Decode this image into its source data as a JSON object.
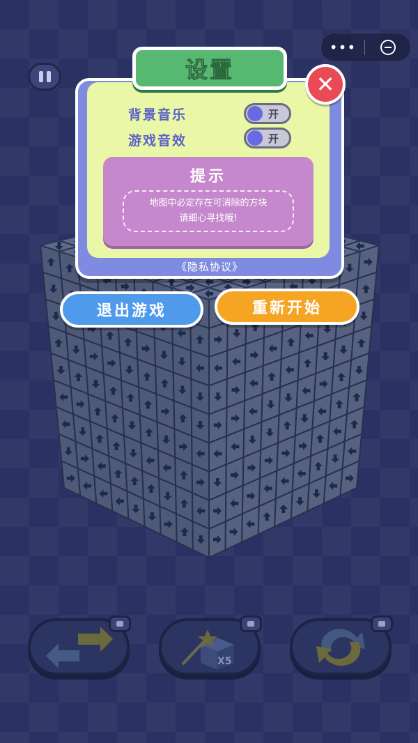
{
  "capsule": {
    "more_glyph": "•••",
    "close_icon": "minimize-circle-icon"
  },
  "pause_icon": "pause-icon",
  "settings": {
    "title": "设置",
    "close_glyph": "✕",
    "rows": [
      {
        "label": "背景音乐",
        "toggle_text": "开",
        "on": true
      },
      {
        "label": "游戏音效",
        "toggle_text": "开",
        "on": true
      }
    ],
    "hint": {
      "title": "提示",
      "lines": [
        "地图中必定存在可消除的方块",
        "请细心寻找哦!"
      ]
    },
    "privacy": "《隐私协议》"
  },
  "buttons": {
    "exit": "退出游戏",
    "restart": "重新开始"
  },
  "tools": [
    {
      "name": "swap-tool",
      "icon": "swap-arrows-icon",
      "badge_icon": "video-icon"
    },
    {
      "name": "magic-tool",
      "icon": "magic-wand-cube-icon",
      "badge_icon": "video-icon",
      "count": "X5"
    },
    {
      "name": "rotate-tool",
      "icon": "rotate-arrows-icon",
      "badge_icon": "video-icon"
    }
  ],
  "colors": {
    "background": "#2b3263",
    "panel_inner": "#e9f7a7",
    "title_green": "#57b971",
    "hint_purple": "#c688cd",
    "exit_blue": "#4f9aea",
    "restart_orange": "#f5a423",
    "close_red": "#ea4a55"
  }
}
